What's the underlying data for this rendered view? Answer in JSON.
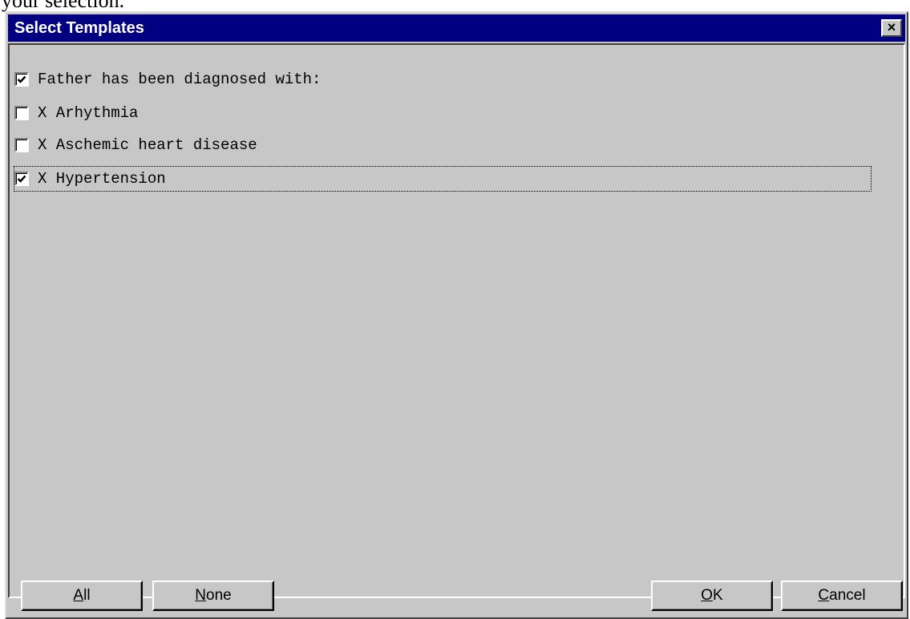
{
  "background_doc": {
    "text": "your selection."
  },
  "dialog": {
    "title": "Select Templates",
    "close_label": "×"
  },
  "items": [
    {
      "label": "Father has been diagnosed with:",
      "checked": true,
      "focused": false
    },
    {
      "label": "X Arhythmia",
      "checked": false,
      "focused": false
    },
    {
      "label": "X Aschemic heart disease",
      "checked": false,
      "focused": false
    },
    {
      "label": "X Hypertension",
      "checked": true,
      "focused": true
    }
  ],
  "buttons": {
    "all": {
      "mnemonic": "A",
      "rest": "ll"
    },
    "none": {
      "mnemonic": "N",
      "rest": "one"
    },
    "ok": {
      "mnemonic": "O",
      "rest": "K"
    },
    "cancel": {
      "mnemonic": "C",
      "rest": "ancel"
    }
  }
}
